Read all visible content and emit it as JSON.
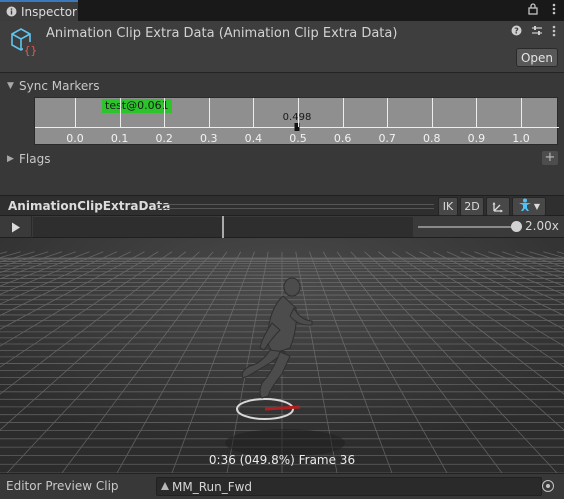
{
  "tab": {
    "label": "Inspector",
    "icon": "info-icon"
  },
  "window_controls": {
    "lock_icon": "lock-icon",
    "menu_icon": "kebab-menu-icon"
  },
  "header": {
    "title": "Animation Clip Extra Data (Animation Clip Extra Data)",
    "icon": "scriptable-object-icon",
    "help_icon": "help-icon",
    "presets_icon": "presets-icon",
    "menu_icon": "kebab-menu-icon",
    "open_label": "Open"
  },
  "sync_markers": {
    "label": "Sync Markers",
    "marker_label": "test@0.061",
    "cursor_value": "0.498",
    "ticks": [
      "0.0",
      "0.1",
      "0.2",
      "0.3",
      "0.4",
      "0.5",
      "0.6",
      "0.7",
      "0.8",
      "0.9",
      "1.0"
    ],
    "marker_color": "#2bc52b"
  },
  "flags": {
    "label": "Flags",
    "add_icon": "plus-icon"
  },
  "preview": {
    "title": "AnimationClipExtraData",
    "ik_label": "IK",
    "twod_label": "2D",
    "pivot_icon": "pivot-icon",
    "avatar_icon": "avatar-icon",
    "dropdown_icon": "chevron-down-icon",
    "play_icon": "play-icon",
    "speed": "2.00x",
    "frame_label": "0:36 (049.8%) Frame 36"
  },
  "footer": {
    "label": "Editor Preview Clip",
    "clip_icon": "animation-clip-icon",
    "clip_name": "MM_Run_Fwd",
    "picker_icon": "object-picker-icon"
  }
}
